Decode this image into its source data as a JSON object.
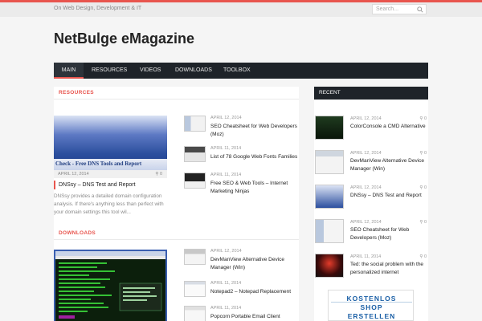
{
  "site": {
    "tagline": "On Web Design, Development & IT",
    "title": "NetBulge eMagazine",
    "search_placeholder": "Search..."
  },
  "nav": {
    "items": [
      {
        "label": "MAIN",
        "active": true
      },
      {
        "label": "RESOURCES",
        "active": false
      },
      {
        "label": "VIDEOS",
        "active": false
      },
      {
        "label": "DOWNLOADS",
        "active": false
      },
      {
        "label": "TOOLBOX",
        "active": false
      }
    ]
  },
  "resources": {
    "heading": "RESOURCES",
    "featured": {
      "image_caption": "Check - Free DNS Tools and Report",
      "date": "APRIL 12, 2014",
      "comments": "0",
      "title": "DNSsy – DNS Test and Report",
      "excerpt": "DNSsy provides a detailed domain configuration analysis. If there's anything less than perfect with your domain settings this tool wil..."
    },
    "posts": [
      {
        "date": "APRIL 12, 2014",
        "title": "SEO Cheatsheet for Web Developers (Moz)"
      },
      {
        "date": "APRIL 11, 2014",
        "title": "List of 78 Google Web Fonts Families"
      },
      {
        "date": "APRIL 11, 2014",
        "title": "Free SEO & Web Tools – Internet Marketing Ninjas"
      }
    ]
  },
  "downloads": {
    "heading": "DOWNLOADS",
    "posts": [
      {
        "date": "APRIL 12, 2014",
        "title": "DevManView Alternative Device Manager (Win)"
      },
      {
        "date": "APRIL 11, 2014",
        "title": "Notepad2 – Notepad Replacement"
      },
      {
        "date": "APRIL 11, 2014",
        "title": "Popcorn Portable Email Client"
      }
    ]
  },
  "sidebar": {
    "heading": "RECENT",
    "posts": [
      {
        "date": "APRIL 12, 2014",
        "comments": "0",
        "title": "ColorConsole a CMD Alternative"
      },
      {
        "date": "APRIL 12, 2014",
        "comments": "0",
        "title": "DevManView Alternative Device Manager (Win)"
      },
      {
        "date": "APRIL 12, 2014",
        "comments": "0",
        "title": "DNSsy – DNS Test and Report"
      },
      {
        "date": "APRIL 12, 2014",
        "comments": "0",
        "title": "SEO Cheatsheet for Web Developers (Moz)"
      },
      {
        "date": "APRIL 11, 2014",
        "comments": "0",
        "title": "Ted: the social problem with the personalized internet"
      }
    ],
    "ad": {
      "line1": "KOSTENLOS",
      "line2": "SHOP",
      "line3": "ERSTELLEN"
    }
  },
  "colors": {
    "accent": "#e8554e",
    "nav_bg": "#1e2329",
    "page_bg": "#f5f5f5"
  }
}
